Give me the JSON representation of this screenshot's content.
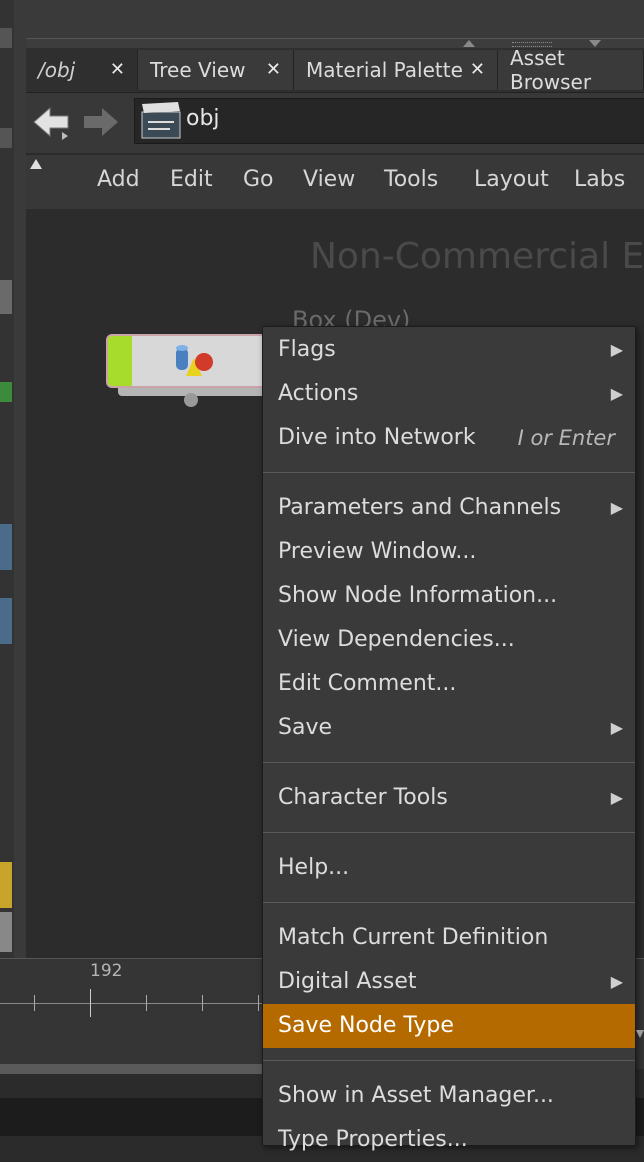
{
  "tabs": [
    {
      "label": "/obj",
      "active": true
    },
    {
      "label": "Tree View",
      "active": false
    },
    {
      "label": "Material Palette",
      "active": false
    },
    {
      "label": "Asset Browser",
      "active": false
    }
  ],
  "path": {
    "text": "obj"
  },
  "menu_bar": [
    "Add",
    "Edit",
    "Go",
    "View",
    "Tools",
    "Layout",
    "Labs"
  ],
  "network": {
    "watermark": "Non-Commercial E",
    "node_label": "Box (Dev)"
  },
  "timeline": {
    "frame": "192"
  },
  "context_menu": {
    "items": [
      {
        "label": "Flags",
        "submenu": true
      },
      {
        "label": "Actions",
        "submenu": true
      },
      {
        "label": "Dive into Network",
        "shortcut": "I or Enter"
      },
      {
        "label": "Parameters and Channels",
        "submenu": true
      },
      {
        "label": "Preview Window..."
      },
      {
        "label": "Show Node Information..."
      },
      {
        "label": "View Dependencies..."
      },
      {
        "label": "Edit Comment..."
      },
      {
        "label": "Save",
        "submenu": true
      },
      {
        "label": "Character Tools",
        "submenu": true
      },
      {
        "label": "Help..."
      },
      {
        "label": "Match Current Definition"
      },
      {
        "label": "Digital Asset",
        "submenu": true
      },
      {
        "label": "Save Node Type",
        "highlighted": true
      },
      {
        "label": "Show in Asset Manager..."
      },
      {
        "label": "Type Properties..."
      }
    ]
  },
  "colors": {
    "highlight": "#b56a00",
    "node_flag": "#a8dc2c",
    "background": "#2c2c2c"
  },
  "icons": [
    "back-arrow-icon",
    "forward-arrow-icon",
    "clapboard-icon",
    "geometry-icon",
    "close-icon",
    "submenu-arrow-icon"
  ]
}
